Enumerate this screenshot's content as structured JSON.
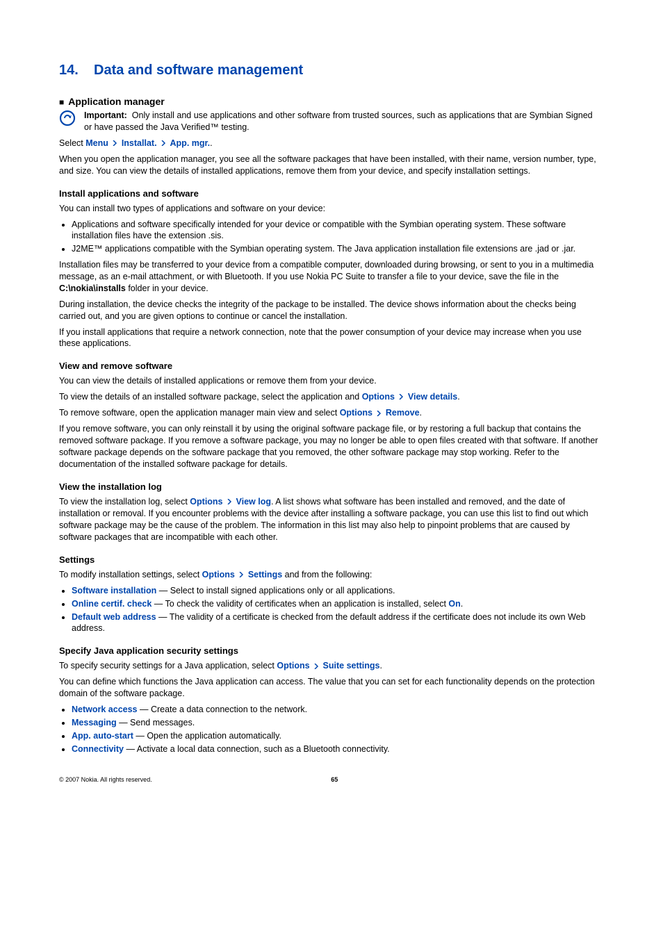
{
  "chapter": {
    "number": "14.",
    "title": "Data and software management"
  },
  "section": {
    "title": "Application manager"
  },
  "important": {
    "label": "Important:",
    "text": "Only install and use applications and other software from trusted sources, such as applications that are Symbian Signed or have passed the Java Verified™ testing."
  },
  "select_line": {
    "prefix": "Select ",
    "menu": "Menu",
    "installat": "Installat.",
    "appmgr": "App. mgr.",
    "suffix": "."
  },
  "intro_para": "When you open the application manager, you see all the software packages that have been installed, with their name, version number, type, and size. You can view the details of installed applications, remove them from your device, and specify installation settings.",
  "install_apps": {
    "heading": "Install applications and software",
    "intro": "You can install two types of applications and software on your device:",
    "bullets": [
      "Applications and software specifically intended for your device or compatible with the Symbian operating system. These software installation files have the extension .sis.",
      "J2ME™ applications compatible with the Symbian operating system. The Java application installation file extensions are .jad or .jar."
    ],
    "p1_a": "Installation files may be transferred to your device from a compatible computer, downloaded during browsing, or sent to you in a multimedia message, as an e-mail attachment, or with Bluetooth. If you use Nokia PC Suite to transfer a file to your device, save the file in the ",
    "p1_bold": "C:\\nokia\\installs",
    "p1_b": " folder in your device.",
    "p2": "During installation, the device checks the integrity of the package to be installed. The device shows information about the checks being carried out, and you are given options to continue or cancel the installation.",
    "p3": "If you install applications that require a network connection, note that the power consumption of your device may increase when you use these applications."
  },
  "view_remove": {
    "heading": "View and remove software",
    "p1": "You can view the details of installed applications or remove them from your device.",
    "p2_a": "To view the details of an installed software package, select the application and ",
    "p2_options": "Options",
    "p2_viewdetails": "View details",
    "p3_a": "To remove software, open the application manager main view and select ",
    "p3_options": "Options",
    "p3_remove": "Remove",
    "p4": "If you remove software, you can only reinstall it by using the original software package file, or by restoring a full backup that contains the removed software package. If you remove a software package, you may no longer be able to open files created with that software. If another software package depends on the software package that you removed, the other software package may stop working. Refer to the documentation of the installed software package for details."
  },
  "view_log": {
    "heading": "View the installation log",
    "p_a": "To view the installation log, select ",
    "p_options": "Options",
    "p_viewlog": "View log",
    "p_b": ". A list shows what software has been installed and removed, and the date of installation or removal. If you encounter problems with the device after installing a software package, you can use this list to find out which software package may be the cause of the problem. The information in this list may also help to pinpoint problems that are caused by software packages that are incompatible with each other."
  },
  "settings": {
    "heading": "Settings",
    "intro_a": "To modify installation settings, select ",
    "intro_options": "Options",
    "intro_settings": "Settings",
    "intro_b": " and from the following:",
    "items": [
      {
        "name": "Software installation",
        "desc": " — Select to install signed applications only or all applications."
      },
      {
        "name": "Online certif. check",
        "desc": " — To check the validity of certificates when an application is installed, select ",
        "trail": "On",
        "trail2": "."
      },
      {
        "name": "Default web address",
        "desc": " — The validity of a certificate is checked from the default address if the certificate does not include its own Web address."
      }
    ]
  },
  "java_sec": {
    "heading": "Specify Java application security settings",
    "p1_a": "To specify security settings for a Java application, select ",
    "p1_options": "Options",
    "p1_suite": "Suite settings",
    "p2": "You can define which functions the Java application can access. The value that you can set for each functionality depends on the protection domain of the software package.",
    "items": [
      {
        "name": "Network access",
        "desc": " — Create a data connection to the network."
      },
      {
        "name": "Messaging",
        "desc": " — Send messages."
      },
      {
        "name": "App. auto-start",
        "desc": " — Open the application automatically."
      },
      {
        "name": "Connectivity",
        "desc": " — Activate a local data connection, such as a Bluetooth connectivity."
      }
    ]
  },
  "footer": {
    "copyright": "© 2007 Nokia. All rights reserved.",
    "page": "65"
  }
}
